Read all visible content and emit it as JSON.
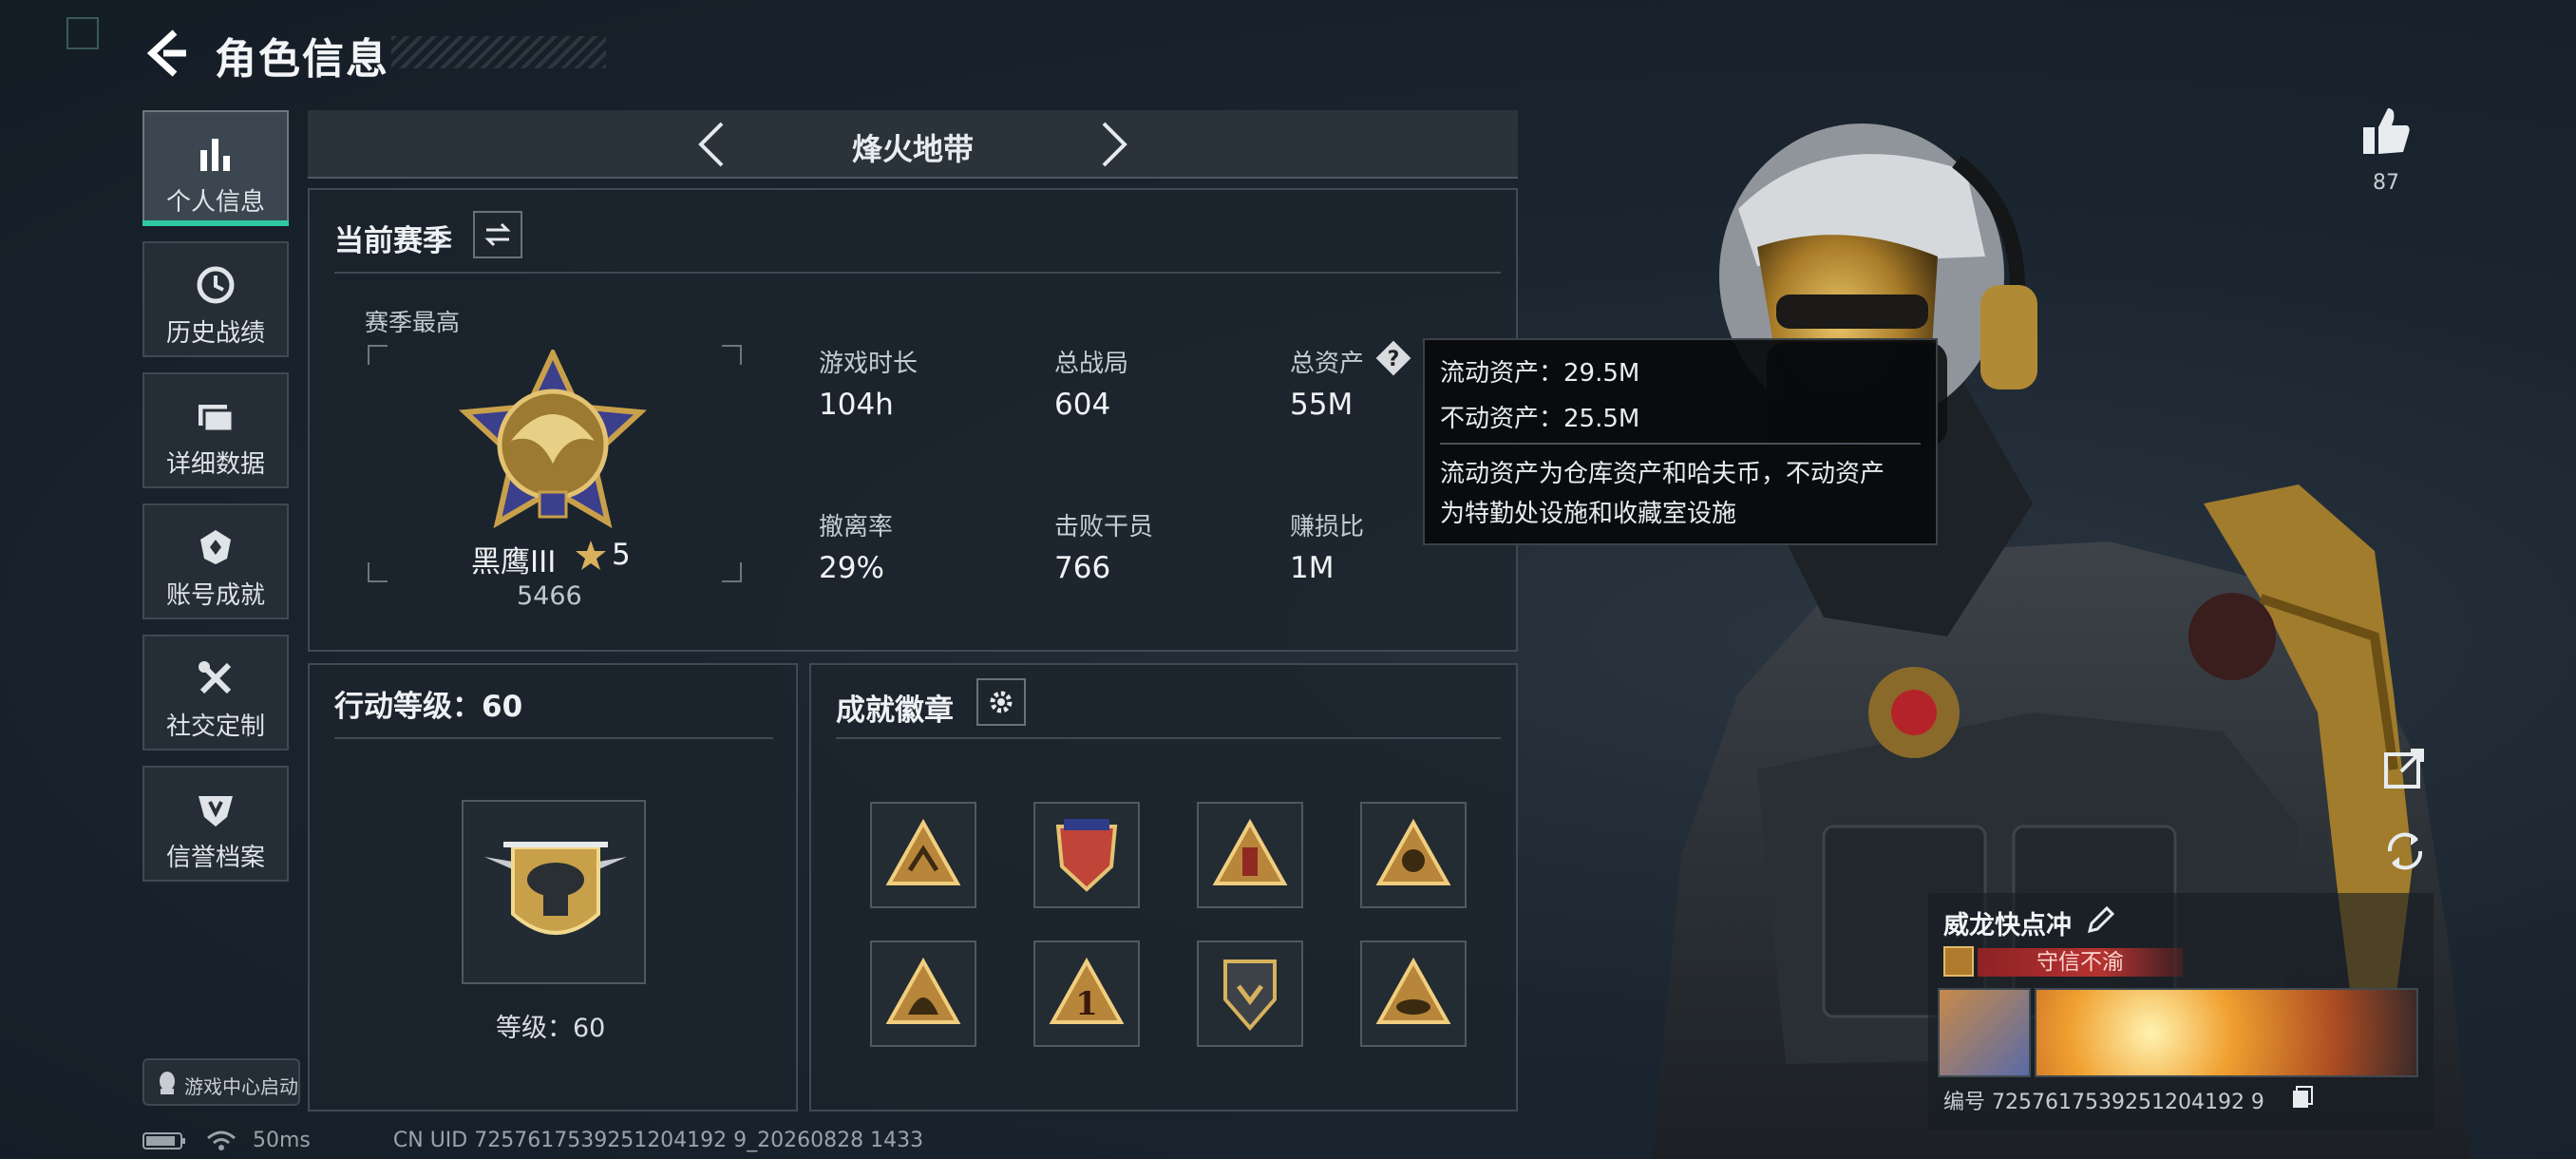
{
  "header": {
    "title": "角色信息"
  },
  "sidebar": {
    "items": [
      {
        "label": "个人信息",
        "icon": "bar-chart-icon",
        "active": true
      },
      {
        "label": "历史战绩",
        "icon": "history-icon",
        "active": false
      },
      {
        "label": "详细数据",
        "icon": "folder-icon",
        "active": false
      },
      {
        "label": "账号成就",
        "icon": "achievement-icon",
        "active": false
      },
      {
        "label": "社交定制",
        "icon": "tools-icon",
        "active": false
      },
      {
        "label": "信誉档案",
        "icon": "credit-shield-icon",
        "active": false
      }
    ],
    "game_center": "游戏中心启动"
  },
  "status_bar": {
    "ping": "50ms",
    "uid": "CN UID 7257617539251204192 9_20260828 1433"
  },
  "mode": {
    "title": "烽火地带"
  },
  "season": {
    "title": "当前赛季",
    "best_label": "赛季最高",
    "rank_name": "黑鹰III",
    "rank_stars": "5",
    "rank_score": "5466",
    "stats": [
      {
        "label": "游戏时长",
        "value": "104h"
      },
      {
        "label": "总战局",
        "value": "604"
      },
      {
        "label": "总资产",
        "value": "55M"
      },
      {
        "label": "撤离率",
        "value": "29%"
      },
      {
        "label": "击败干员",
        "value": "766"
      },
      {
        "label": "赚损比",
        "value": "1M"
      }
    ]
  },
  "tooltip": {
    "line1": "流动资产：29.5M",
    "line2": "不动资产：25.5M",
    "desc1": "流动资产为仓库资产和哈夫币，不动资产",
    "desc2": "为特勤处设施和收藏室设施"
  },
  "level": {
    "title": "行动等级：60",
    "caption": "等级：60"
  },
  "achievements": {
    "title": "成就徽章"
  },
  "character": {
    "likes": "87",
    "name": "威龙快点冲",
    "tag": "守信不渝",
    "id_label": "编号 7257617539251204192 9"
  },
  "colors": {
    "accent": "#2fc8a3",
    "gold": "#c9a04a",
    "tag_red": "#8e2224"
  }
}
